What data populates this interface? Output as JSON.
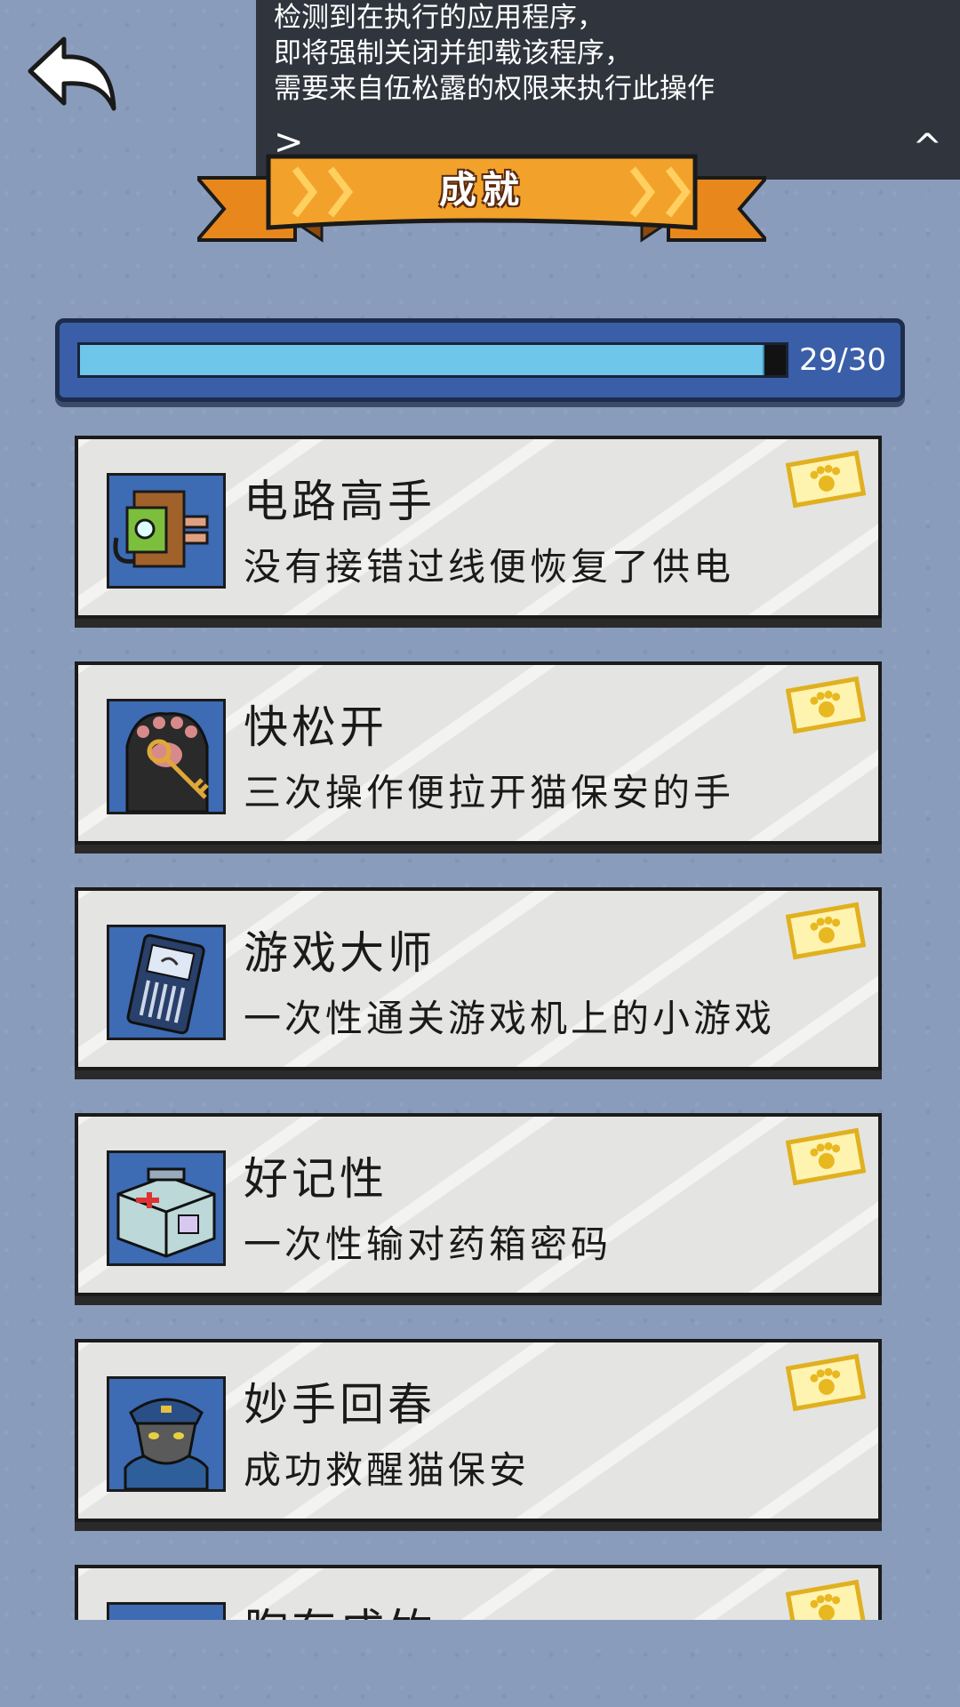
{
  "overlay": {
    "lines": [
      "检测到在执行的应用程序，",
      "即将强制关闭并卸载该程序，",
      "需要来自伍松露的权限来执行此操作"
    ],
    "expand_label": ">",
    "collapse_label": "^"
  },
  "header": {
    "title": "成就"
  },
  "progress": {
    "label": "29/30",
    "value": 29,
    "max": 30
  },
  "achievements": [
    {
      "title": "电路高手",
      "desc": "没有接错过线便恢复了供电",
      "icon": "power-plug-icon"
    },
    {
      "title": "快松开",
      "desc": "三次操作便拉开猫保安的手",
      "icon": "cat-paw-key-icon"
    },
    {
      "title": "游戏大师",
      "desc": "一次性通关游戏机上的小游戏",
      "icon": "game-device-icon"
    },
    {
      "title": "好记性",
      "desc": "一次性输对药箱密码",
      "icon": "medicine-box-icon"
    },
    {
      "title": "妙手回春",
      "desc": "成功救醒猫保安",
      "icon": "cat-guard-icon"
    },
    {
      "title": "胸有成竹",
      "desc": "",
      "icon": "character-icon"
    }
  ],
  "colors": {
    "progress_fill": "#6ec6ea",
    "banner": "#f2a22a",
    "frame": "#3a5fa8"
  }
}
